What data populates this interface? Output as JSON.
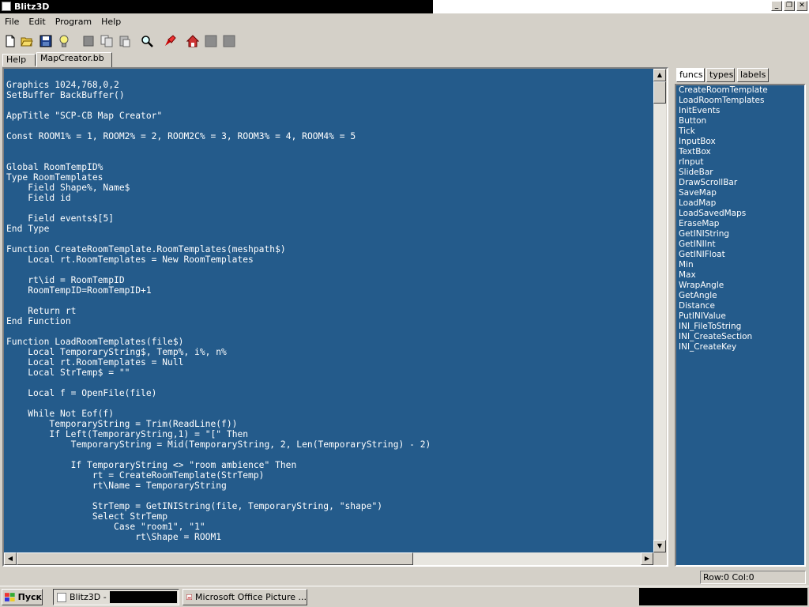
{
  "window": {
    "title": "Blitz3D",
    "controls": [
      "_",
      "❐",
      "✕"
    ]
  },
  "menu": [
    "File",
    "Edit",
    "Program",
    "Help"
  ],
  "toolbar": [
    {
      "name": "new-file-icon"
    },
    {
      "name": "open-folder-icon"
    },
    {
      "name": "save-icon"
    },
    {
      "name": "lightbulb-icon"
    },
    {
      "name": "cut-icon"
    },
    {
      "name": "copy-icon"
    },
    {
      "name": "paste-icon"
    },
    {
      "name": "find-icon"
    },
    {
      "name": "run-icon"
    },
    {
      "name": "home-icon"
    },
    {
      "name": "back-icon"
    },
    {
      "name": "forward-icon"
    }
  ],
  "tabs": [
    {
      "label": "Help",
      "active": false
    },
    {
      "label": "MapCreator.bb",
      "active": true
    }
  ],
  "code": [
    [
      [
        "k",
        "Graphics "
      ],
      [
        "n",
        "1024,768,0,2"
      ]
    ],
    [
      [
        "k",
        "SetBuffer BackBuffer()"
      ]
    ],
    [],
    [
      [
        "k",
        "AppTitle "
      ],
      [
        "s",
        "\"SCP-CB Map Creator\""
      ]
    ],
    [],
    [
      [
        "k",
        "Const ROOM1% = "
      ],
      [
        "n",
        "1"
      ],
      [
        "k",
        ", ROOM2% = "
      ],
      [
        "n",
        "2"
      ],
      [
        "k",
        ", ROOM2C% = "
      ],
      [
        "n",
        "3"
      ],
      [
        "k",
        ", ROOM3% = "
      ],
      [
        "n",
        "4"
      ],
      [
        "k",
        ", ROOM4% = "
      ],
      [
        "n",
        "5"
      ]
    ],
    [],
    [],
    [
      [
        "k",
        "Global RoomTempID%"
      ]
    ],
    [
      [
        "k",
        "Type RoomTemplates"
      ]
    ],
    [
      [
        "k",
        "    Field Shape%, Name$"
      ]
    ],
    [
      [
        "k",
        "    Field id"
      ]
    ],
    [],
    [
      [
        "k",
        "    Field events$["
      ],
      [
        "n",
        "5"
      ],
      [
        "k",
        "]"
      ]
    ],
    [
      [
        "k",
        "End Type"
      ]
    ],
    [],
    [
      [
        "k",
        "Function CreateRoomTemplate.RoomTemplates(meshpath$)"
      ]
    ],
    [
      [
        "k",
        "    Local rt.RoomTemplates = New RoomTemplates"
      ]
    ],
    [],
    [
      [
        "k",
        "    rt\\id = RoomTempID"
      ]
    ],
    [
      [
        "k",
        "    RoomTempID=RoomTempID+"
      ],
      [
        "n",
        "1"
      ]
    ],
    [],
    [
      [
        "k",
        "    Return rt"
      ]
    ],
    [
      [
        "k",
        "End Function"
      ]
    ],
    [],
    [
      [
        "k",
        "Function LoadRoomTemplates(file$)"
      ]
    ],
    [
      [
        "k",
        "    Local TemporaryString$, Temp%, i%, n%"
      ]
    ],
    [
      [
        "k",
        "    Local rt.RoomTemplates = Null"
      ]
    ],
    [
      [
        "k",
        "    Local StrTemp$ = "
      ],
      [
        "s",
        "\"\""
      ]
    ],
    [],
    [
      [
        "k",
        "    Local f = OpenFile(file)"
      ]
    ],
    [],
    [
      [
        "k",
        "    While Not Eof(f)"
      ]
    ],
    [
      [
        "k",
        "        TemporaryString = Trim(ReadLine(f))"
      ]
    ],
    [
      [
        "k",
        "        If Left(TemporaryString,"
      ],
      [
        "n",
        "1"
      ],
      [
        "k",
        ") = "
      ],
      [
        "s",
        "\"[\""
      ],
      [
        "k",
        " Then"
      ]
    ],
    [
      [
        "k",
        "            TemporaryString = Mid(TemporaryString, "
      ],
      [
        "n",
        "2"
      ],
      [
        "k",
        ", Len(TemporaryString) - "
      ],
      [
        "n",
        "2"
      ],
      [
        "k",
        ")"
      ]
    ],
    [],
    [
      [
        "k",
        "            If TemporaryString <> "
      ],
      [
        "s",
        "\"room ambience\""
      ],
      [
        "k",
        " Then"
      ]
    ],
    [
      [
        "k",
        "                rt = CreateRoomTemplate(StrTemp)"
      ]
    ],
    [
      [
        "k",
        "                rt\\Name = TemporaryString"
      ]
    ],
    [],
    [
      [
        "k",
        "                StrTemp = GetINIString(file, TemporaryString, "
      ],
      [
        "s",
        "\"shape\""
      ],
      [
        "k",
        ")"
      ]
    ],
    [
      [
        "k",
        "                Select StrTemp"
      ]
    ],
    [
      [
        "k",
        "                    Case "
      ],
      [
        "s",
        "\"room1\""
      ],
      [
        "k",
        ", "
      ],
      [
        "s",
        "\"1\""
      ]
    ],
    [
      [
        "k",
        "                        rt\\Shape = ROOM1"
      ]
    ]
  ],
  "side_tabs": [
    {
      "label": "funcs",
      "active": true
    },
    {
      "label": "types",
      "active": false
    },
    {
      "label": "labels",
      "active": false
    }
  ],
  "functions": [
    "CreateRoomTemplate",
    "LoadRoomTemplates",
    "InitEvents",
    "Button",
    "Tick",
    "InputBox",
    "TextBox",
    "rInput",
    "SlideBar",
    "DrawScrollBar",
    "SaveMap",
    "LoadMap",
    "LoadSavedMaps",
    "EraseMap",
    "GetINIString",
    "GetINIInt",
    "GetINIFloat",
    "Min",
    "Max",
    "WrapAngle",
    "GetAngle",
    "Distance",
    "PutINIValue",
    "INI_FileToString",
    "INI_CreateSection",
    "INI_CreateKey"
  ],
  "status": {
    "position": "Row:0 Col:0"
  },
  "taskbar": {
    "start_label": "Пуск",
    "tasks": [
      {
        "label": "Blitz3D -",
        "active": true
      },
      {
        "label": "Microsoft Office Picture ...",
        "active": false
      }
    ]
  }
}
